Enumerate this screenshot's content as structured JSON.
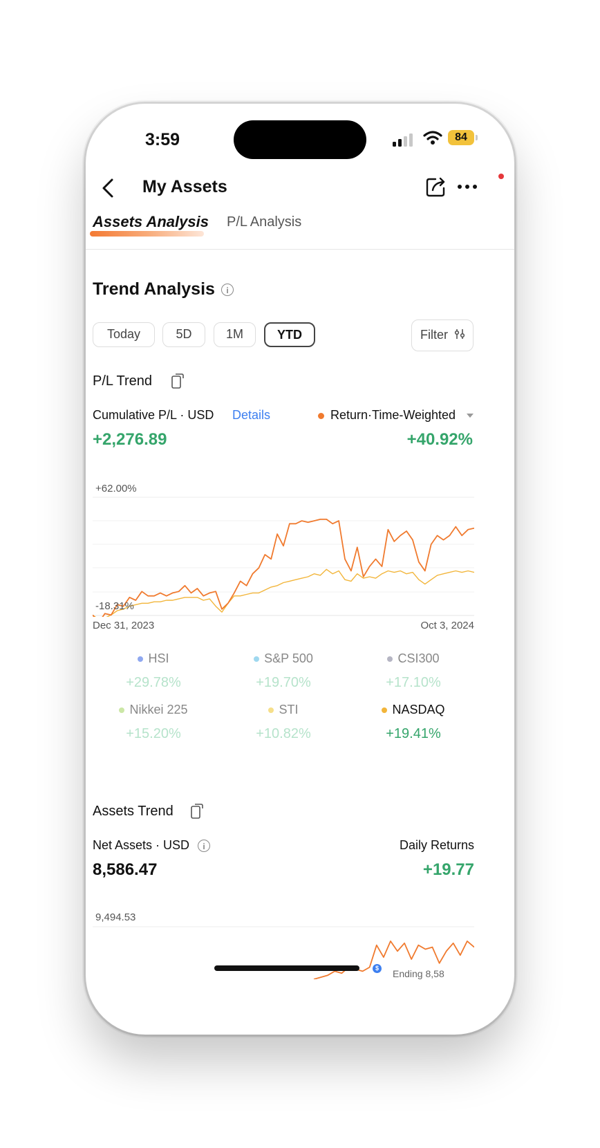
{
  "status_bar": {
    "time": "3:59",
    "battery": "84"
  },
  "header": {
    "title": "My Assets"
  },
  "tabs": [
    {
      "label": "Assets Analysis",
      "active": true
    },
    {
      "label": "P/L Analysis",
      "active": false
    }
  ],
  "trend": {
    "title": "Trend Analysis",
    "periods": [
      {
        "label": "Today",
        "selected": false
      },
      {
        "label": "5D",
        "selected": false
      },
      {
        "label": "1M",
        "selected": false
      },
      {
        "label": "YTD",
        "selected": true
      }
    ],
    "filter_label": "Filter"
  },
  "pl_trend": {
    "title": "P/L Trend",
    "cumulative_label": "Cumulative P/L · USD",
    "details_label": "Details",
    "return_label": "Return·Time-Weighted",
    "cumulative_value": "+2,276.89",
    "return_value": "+40.92%",
    "y_max_label": "+62.00%",
    "y_min_label": "-18.31%",
    "x_start_label": "Dec 31, 2023",
    "x_end_label": "Oct 3, 2024"
  },
  "benchmarks": [
    {
      "name": "HSI",
      "value": "+29.78%",
      "color": "#8fa8f0",
      "active": false
    },
    {
      "name": "S&P 500",
      "value": "+19.70%",
      "color": "#9fd8ef",
      "active": false
    },
    {
      "name": "CSI300",
      "value": "+17.10%",
      "color": "#b5b5c3",
      "active": false
    },
    {
      "name": "Nikkei 225",
      "value": "+15.20%",
      "color": "#cbe7a6",
      "active": false
    },
    {
      "name": "STI",
      "value": "+10.82%",
      "color": "#f6df8a",
      "active": false
    },
    {
      "name": "NASDAQ",
      "value": "+19.41%",
      "color": "#f2b53a",
      "active": true
    }
  ],
  "assets_trend": {
    "title": "Assets Trend",
    "net_assets_label": "Net Assets · USD",
    "daily_returns_label": "Daily Returns",
    "net_assets_value": "8,586.47",
    "daily_returns_value": "+19.77",
    "y_max_label": "9,494.53",
    "ending_label": "Ending 8,58",
    "marker_label": "$"
  },
  "colors": {
    "return_line": "#f07a2e",
    "nasdaq_line": "#f2b53a",
    "positive": "#35a56b",
    "link": "#3d7ff0"
  },
  "chart_data": [
    {
      "type": "line",
      "title": "",
      "x": [
        "Dec 31, 2023",
        "Oct 3, 2024"
      ],
      "ylim": [
        -18.31,
        62.0
      ],
      "series": [
        {
          "name": "Return·Time-Weighted",
          "values": [
            -18,
            -23,
            -17,
            -18,
            -11,
            -12,
            -6,
            -8,
            -2,
            -5,
            -5,
            -3,
            -5,
            -3,
            -2,
            2,
            -3,
            0,
            -5,
            -3,
            -2,
            -14,
            -10,
            -3,
            5,
            2,
            10,
            14,
            23,
            20,
            37,
            29,
            44,
            44,
            46,
            45,
            46,
            47,
            47,
            44,
            46,
            20,
            12,
            28,
            8,
            15,
            20,
            15,
            40,
            32,
            36,
            39,
            33,
            18,
            12,
            30,
            36,
            33,
            36,
            42,
            36,
            40,
            41
          ]
        },
        {
          "name": "NASDAQ",
          "values": [
            -18,
            -21,
            -20,
            -18,
            -15,
            -14,
            -12,
            -11,
            -10,
            -10,
            -9,
            -9,
            -8,
            -8,
            -7,
            -6,
            -6,
            -6,
            -8,
            -7,
            -12,
            -16,
            -10,
            -5,
            -5,
            -4,
            -3,
            -3,
            -1,
            1,
            2,
            4,
            5,
            6,
            7,
            8,
            10,
            9,
            13,
            10,
            12,
            6,
            5,
            10,
            7,
            8,
            7,
            10,
            12,
            11,
            12,
            10,
            11,
            6,
            3,
            6,
            9,
            10,
            11,
            12,
            11,
            12,
            11
          ]
        }
      ]
    },
    {
      "type": "line",
      "title": "",
      "ylim": [
        null,
        9494.53
      ],
      "series": [
        {
          "name": "Net Assets",
          "values": [
            0.0,
            0.05,
            0.1,
            0.2,
            0.15,
            0.3,
            0.25,
            0.2,
            0.3,
            0.85,
            0.55,
            0.95,
            0.7,
            0.9,
            0.5,
            0.85,
            0.75,
            0.8,
            0.4,
            0.7,
            0.9,
            0.6,
            0.95,
            0.8
          ]
        }
      ]
    }
  ]
}
